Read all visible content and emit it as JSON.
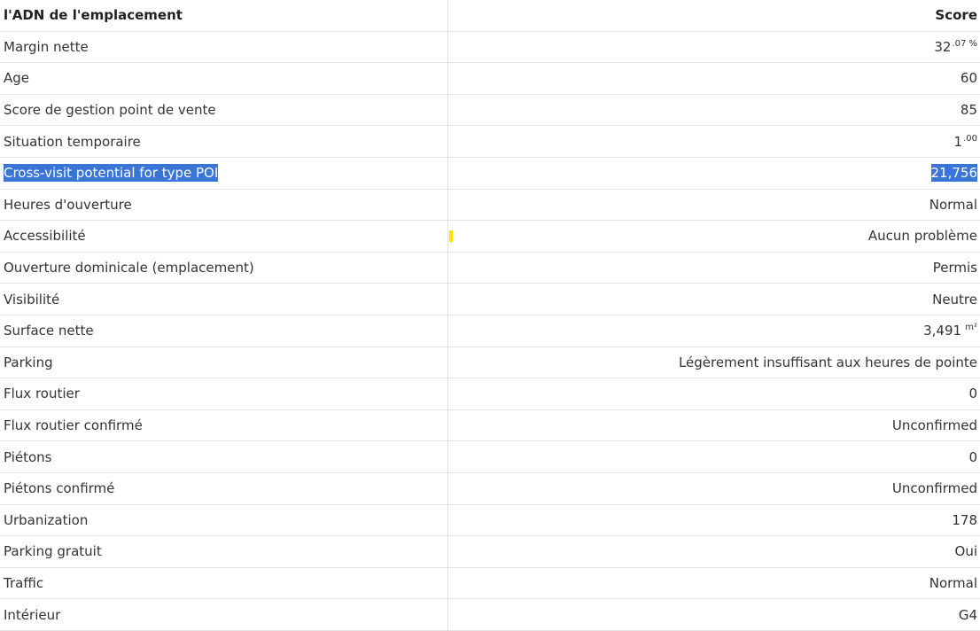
{
  "table": {
    "header": {
      "label": "l'ADN de l'emplacement",
      "score": "Score"
    },
    "rows": [
      {
        "label": "Margin nette",
        "value": "32",
        "sup": ".07 %"
      },
      {
        "label": "Age",
        "value": "60"
      },
      {
        "label": "Score de gestion point de vente",
        "value": "85"
      },
      {
        "label": "Situation temporaire",
        "value": "1",
        "sup": ".00"
      },
      {
        "label": "Cross-visit potential for type POI",
        "value": "21,756",
        "selected": true
      },
      {
        "label": "Heures d'ouverture",
        "value": "Normal"
      },
      {
        "label": "Accessibilité",
        "value": "Aucun problème",
        "marker_color": "#ffe100"
      },
      {
        "label": "Ouverture dominicale (emplacement)",
        "value": "Permis"
      },
      {
        "label": "Visibilité",
        "value": "Neutre"
      },
      {
        "label": "Surface nette",
        "value": "3,491",
        "sup": " m²"
      },
      {
        "label": "Parking",
        "value": "Légèrement insuffisant aux heures de pointe"
      },
      {
        "label": "Flux routier",
        "value": "0"
      },
      {
        "label": "Flux routier confirmé",
        "value": "Unconfirmed"
      },
      {
        "label": "Piétons",
        "value": "0"
      },
      {
        "label": "Piétons confirmé",
        "value": "Unconfirmed"
      },
      {
        "label": "Urbanization",
        "value": "178"
      },
      {
        "label": "Parking gratuit",
        "value": "Oui"
      },
      {
        "label": "Traffic",
        "value": "Normal"
      },
      {
        "label": "Intérieur",
        "value": "G4"
      }
    ]
  },
  "colors": {
    "selection_bg": "#3875d7",
    "selection_text": "#ffffff",
    "border": "#e2e2e2",
    "text": "#333333"
  }
}
